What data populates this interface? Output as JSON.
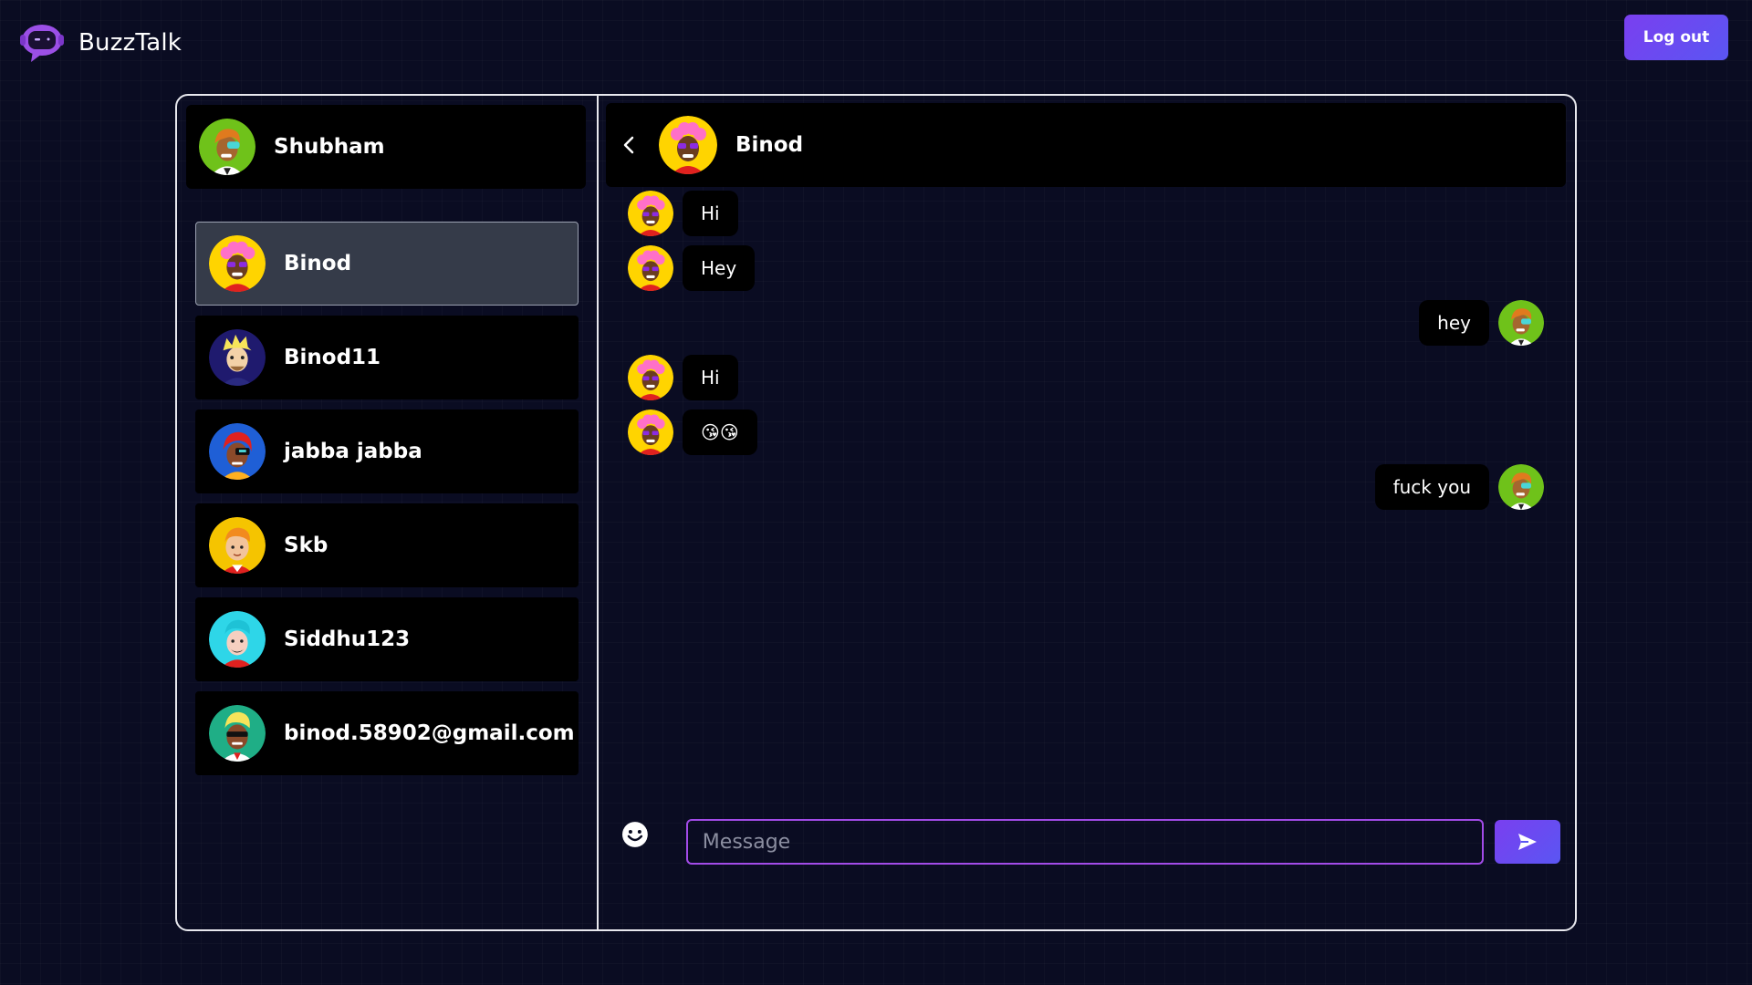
{
  "app": {
    "title": "BuzzTalk"
  },
  "header": {
    "logout_label": "Log out"
  },
  "me": {
    "name": "Shubham",
    "avatar": "avatar-green"
  },
  "contacts": [
    {
      "name": "Binod",
      "avatar": "avatar-pink-hair",
      "active": true
    },
    {
      "name": "Binod11",
      "avatar": "avatar-blonde"
    },
    {
      "name": "jabba jabba",
      "avatar": "avatar-red-hair"
    },
    {
      "name": "Skb",
      "avatar": "avatar-yellow"
    },
    {
      "name": "Siddhu123",
      "avatar": "avatar-cyan"
    },
    {
      "name": "binod.58902@gmail.com",
      "avatar": "avatar-teal"
    }
  ],
  "chat": {
    "title": "Binod",
    "messages": [
      {
        "dir": "in",
        "text": "Hi"
      },
      {
        "dir": "in",
        "text": "Hey"
      },
      {
        "dir": "out",
        "text": "hey"
      },
      {
        "dir": "in",
        "text": "Hi"
      },
      {
        "dir": "in",
        "text": "😘😘"
      },
      {
        "dir": "out",
        "text": "fuck you"
      }
    ],
    "composer": {
      "placeholder": "Message"
    }
  },
  "colors": {
    "accent": "#7a3ff0",
    "background": "#0a0c22",
    "input_border": "#a24be8"
  }
}
